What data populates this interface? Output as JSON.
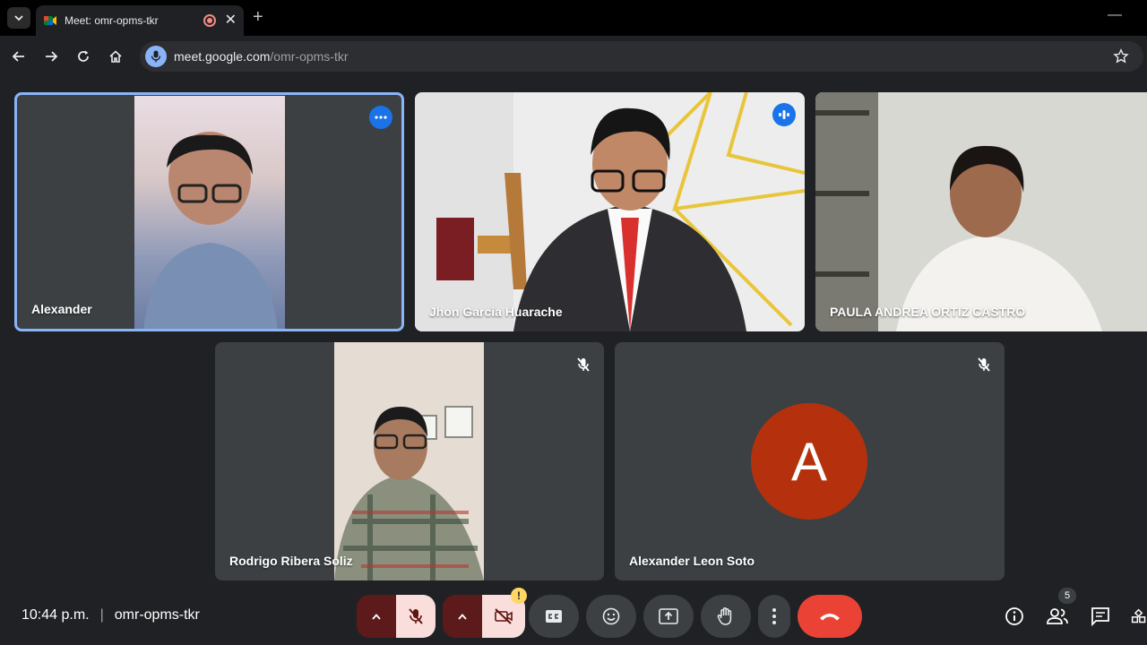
{
  "browser": {
    "tab_title": "Meet: omr-opms-tkr",
    "url_host": "meet.google.com",
    "url_path": "/omr-opms-tkr",
    "new_tab_symbol": "+",
    "close_symbol": "✕",
    "minimize_symbol": "—"
  },
  "participants": [
    {
      "name": "Alexander",
      "video": true,
      "active_speaker": true,
      "badge": "more-options-icon"
    },
    {
      "name": "Jhon Garcia Huarache",
      "video": true,
      "badge": "speaking-indicator-icon"
    },
    {
      "name": "PAULA ANDREA ORTIZ CASTRO",
      "video": true
    },
    {
      "name": "Rodrigo Ribera Soliz",
      "video": true,
      "muted": true
    },
    {
      "name": "Alexander Leon Soto",
      "video": false,
      "muted": true,
      "avatar_letter": "A",
      "avatar_color": "#b5310d"
    }
  ],
  "bottombar": {
    "time": "10:44 p.m.",
    "separator": "|",
    "meeting_code": "omr-opms-tkr",
    "camera_warning": "!",
    "people_count": "5"
  },
  "colors": {
    "accent": "#8ab4f8",
    "end_call": "#ea4335",
    "muted_btn": "#f9dedc",
    "background": "#202124"
  }
}
